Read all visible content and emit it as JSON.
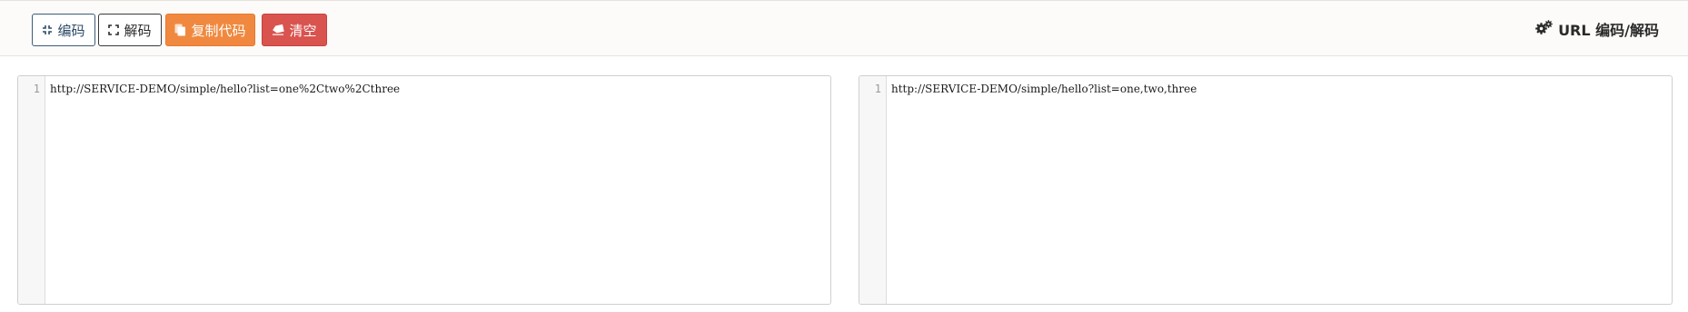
{
  "toolbar": {
    "encode_label": "编码",
    "decode_label": "解码",
    "copy_label": "复制代码",
    "clear_label": "清空",
    "copy_color": "#f0893f",
    "clear_color": "#d9534f"
  },
  "title": {
    "text": "URL 编码/解码",
    "icon": "gears-icon"
  },
  "editors": {
    "left": {
      "line_number": "1",
      "content": "http://SERVICE-DEMO/simple/hello?list=one%2Ctwo%2Cthree"
    },
    "right": {
      "line_number": "1",
      "content": "http://SERVICE-DEMO/simple/hello?list=one,two,three"
    }
  }
}
